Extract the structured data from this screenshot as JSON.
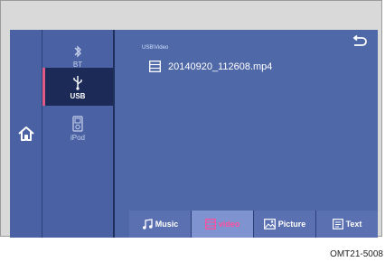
{
  "sources": {
    "bt_label": "BT",
    "usb_label": "USB",
    "ipod_label": "iPod"
  },
  "main": {
    "path": "USB\\Video",
    "file_name": "20140920_112608.mp4"
  },
  "tabs": {
    "music": "Music",
    "video": "video",
    "picture": "Picture",
    "text": "Text"
  },
  "caption": "OMT21-5008",
  "colors": {
    "screen_bg": "#4f68a8",
    "active_source": "#1b2a57",
    "active_tab_text": "#ff4fa0"
  }
}
